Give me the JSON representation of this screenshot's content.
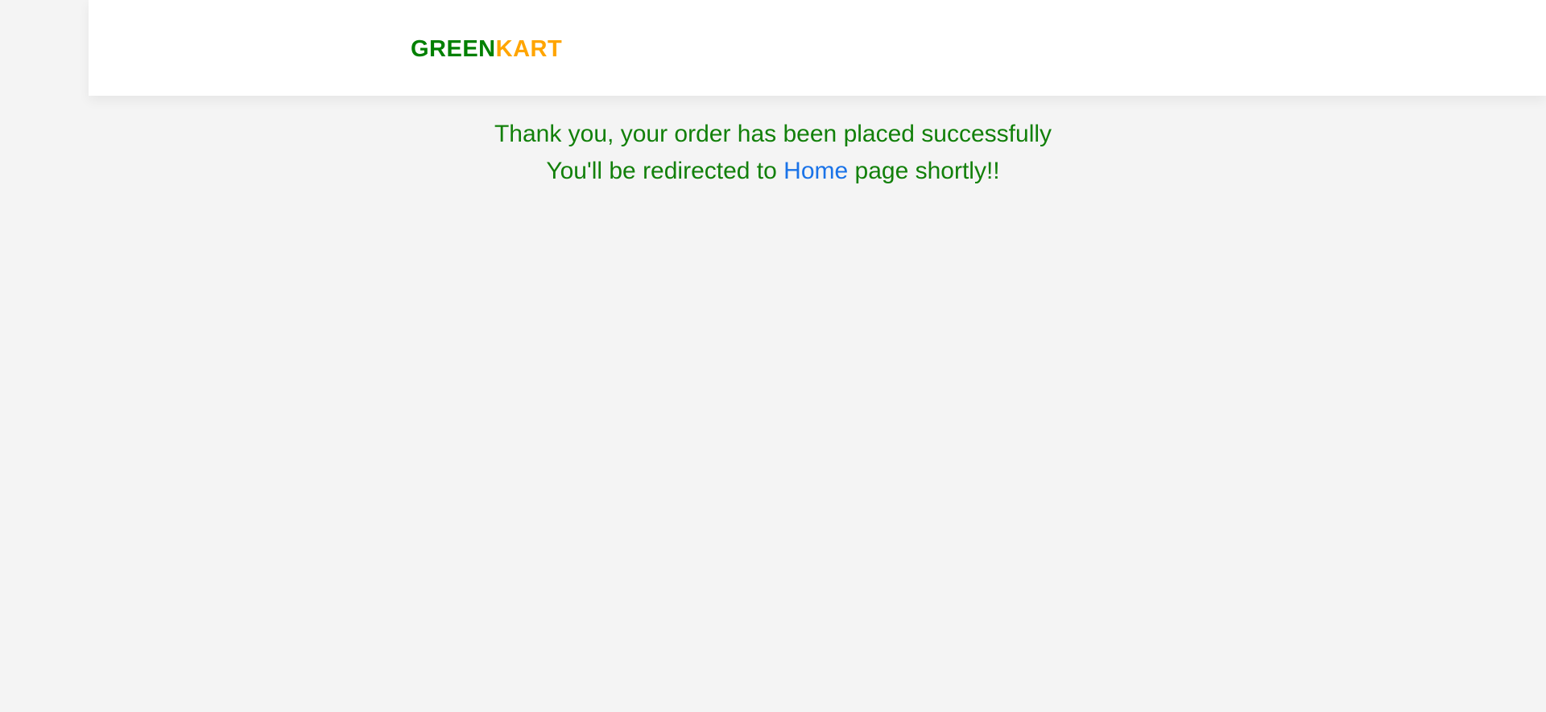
{
  "header": {
    "brand_part1": "GREEN",
    "brand_part2": "KART"
  },
  "message": {
    "line1": "Thank you, your order has been placed successfully",
    "line2_before": "You'll be redirected to ",
    "home_link": "Home",
    "line2_after": " page shortly!!"
  },
  "colors": {
    "background": "#f4f4f4",
    "header_bg": "#ffffff",
    "brand_green": "#008000",
    "brand_orange": "#ffa500",
    "message_text": "#12800a",
    "link": "#1a73e8"
  }
}
